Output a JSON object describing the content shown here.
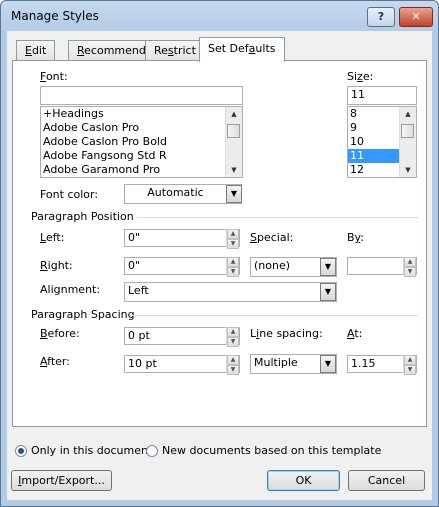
{
  "window": {
    "title": "Manage Styles",
    "help_label": "?",
    "close_label": "✕"
  },
  "tabs": [
    {
      "label_pre": "",
      "accel": "E",
      "label_post": "dit"
    },
    {
      "label_pre": "",
      "accel": "R",
      "label_post": "ecommend"
    },
    {
      "label_pre": "Re",
      "accel": "s",
      "label_post": "trict"
    },
    {
      "label_pre": "Set Def",
      "accel": "a",
      "label_post": "ults"
    }
  ],
  "font": {
    "label_pre": "",
    "accel": "F",
    "label_post": "ont:",
    "value": "",
    "items": [
      "+Headings",
      "Adobe Caslon Pro",
      "Adobe Caslon Pro Bold",
      "Adobe Fangsong Std R",
      "Adobe Garamond Pro"
    ]
  },
  "size": {
    "label_pre": "Si",
    "accel": "z",
    "label_post": "e:",
    "value": "11",
    "items": [
      "8",
      "9",
      "10",
      "11",
      "12"
    ],
    "selected": "11"
  },
  "font_color": {
    "label": "Font color:",
    "value": "Automatic"
  },
  "paragraph_position": {
    "header": "Paragraph Position",
    "left": {
      "label_pre": "",
      "accel": "L",
      "label_post": "eft:",
      "value": "0\""
    },
    "right": {
      "label_pre": "",
      "accel": "R",
      "label_post": "ight:",
      "value": "0\""
    },
    "special": {
      "label_pre": "",
      "accel": "S",
      "label_post": "pecial:",
      "value": "(none)"
    },
    "by": {
      "label_pre": "B",
      "accel": "y",
      "label_post": ":",
      "value": ""
    },
    "alignment": {
      "label": "Alignment:",
      "value": "Left"
    }
  },
  "paragraph_spacing": {
    "header": "Paragraph Spacing",
    "before": {
      "label_pre": "",
      "accel": "B",
      "label_post": "efore:",
      "value": "0 pt"
    },
    "after": {
      "label_pre": "",
      "accel": "A",
      "label_post": "fter:",
      "value": "10 pt"
    },
    "line_spacing": {
      "label_pre": "L",
      "accel": "i",
      "label_post": "ne spacing:",
      "value": "Multiple"
    },
    "at": {
      "label_pre": "",
      "accel": "A",
      "label_post": "t:",
      "value": "1.15"
    }
  },
  "scope": {
    "only_doc": "Only in this document",
    "new_docs": "New documents based on this template",
    "selected": "only_doc"
  },
  "buttons": {
    "import_pre": "",
    "import_accel": "I",
    "import_post": "mport/Export...",
    "ok": "OK",
    "cancel": "Cancel"
  }
}
